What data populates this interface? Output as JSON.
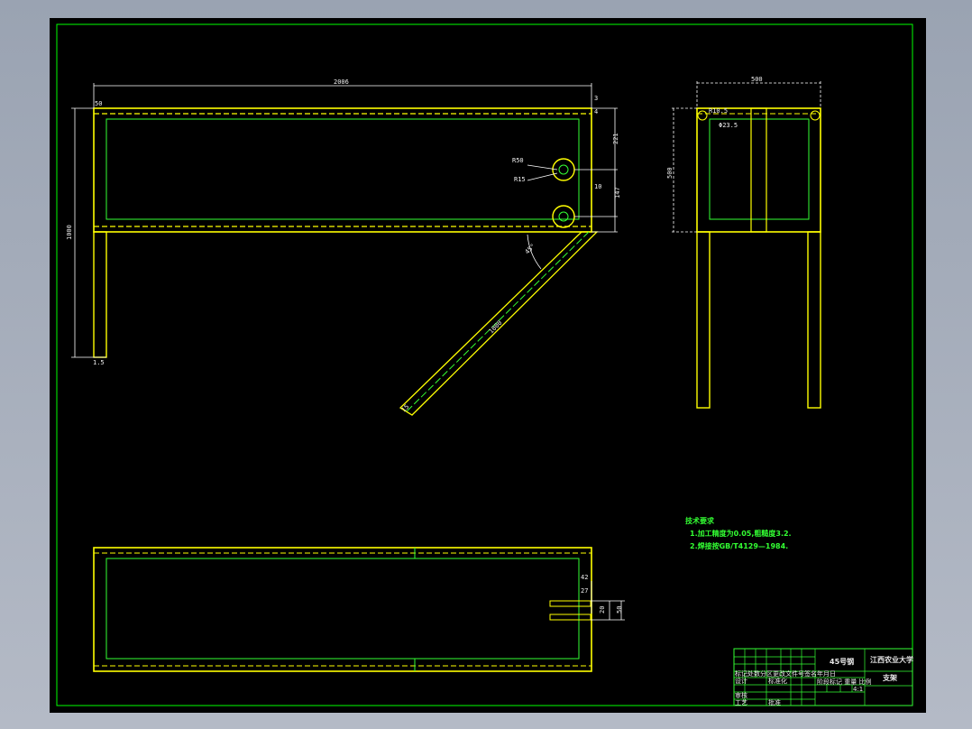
{
  "dims": {
    "d2006": "2006",
    "d50_top": "50",
    "d3": "3",
    "d4": "4",
    "d221": "221",
    "dR50": "R50",
    "dR15": "R15",
    "d10": "10",
    "d147": "147",
    "d1000_left": "1000",
    "d45deg": "45°",
    "d1000_diag": "1000",
    "d15": "15",
    "d15_bottom": "1.5",
    "d500_top": "500",
    "d500_side": "500",
    "dR10_5": "R10.5",
    "dPhi23_5": "Φ23.5",
    "d42": "42",
    "d27": "27",
    "d20": "20",
    "d50_right": "50"
  },
  "notes": {
    "title": "技术要求",
    "line1": "1.加工精度为0.05,粗糙度3.2.",
    "line2": "2.焊接按GB/T4129—1984."
  },
  "titleblock": {
    "material": "45号钢",
    "school": "江西农业大学",
    "part_name": "支架",
    "header_row": "标记处数分区更改文件号签名年月日",
    "design_label": "设计",
    "standard_label": "标准化",
    "check_label": "审核",
    "process_label": "工艺",
    "approve_label": "批准",
    "stage_row": "阶段标记 重量 比例",
    "scale": "4:1"
  },
  "colors": {
    "outline": "#ffff00",
    "thin": "#33ff33",
    "dim": "#ffffff",
    "frame": "#00ff00"
  }
}
